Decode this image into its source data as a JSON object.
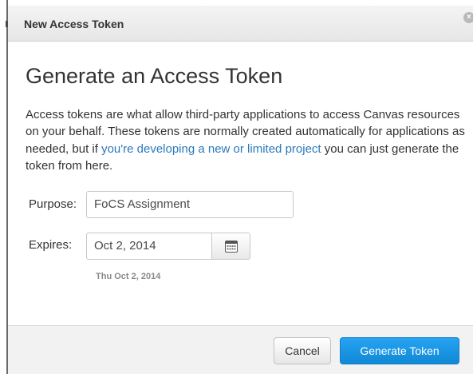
{
  "dialog": {
    "title": "New Access Token",
    "close_icon": "close-icon"
  },
  "main": {
    "heading": "Generate an Access Token",
    "description_before_link": "Access tokens are what allow third-party applications to access Canvas resources on your behalf. These tokens are normally created automatically for applications as needed, but if ",
    "description_link": "you're developing a new or limited project",
    "description_after_link": " you can just generate the token from here."
  },
  "form": {
    "purpose_label": "Purpose:",
    "purpose_value": "FoCS Assignment",
    "expires_label": "Expires:",
    "expires_value": "Oct 2, 2014",
    "calendar_icon": "calendar-icon",
    "expires_hint": "Thu Oct 2, 2014"
  },
  "footer": {
    "cancel_label": "Cancel",
    "generate_label": "Generate Token"
  },
  "colors": {
    "primary_button": "#1a93e3",
    "link": "#2a7abc"
  }
}
